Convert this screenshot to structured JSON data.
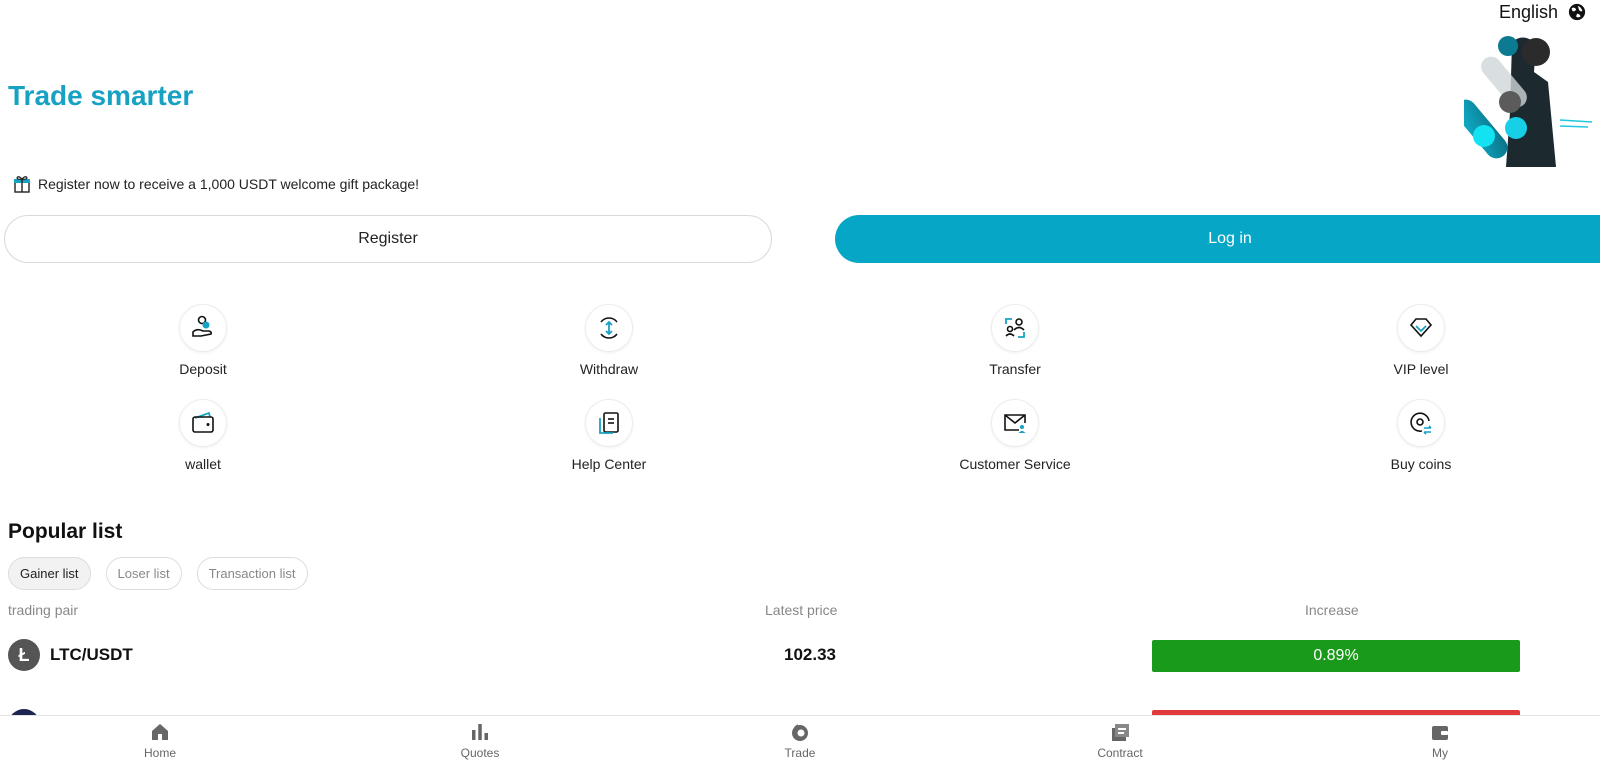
{
  "header": {
    "language": "English",
    "language_icon": "globe-icon"
  },
  "hero": {
    "title": "Trade smarter",
    "art_icon": "promo-athlete-image"
  },
  "gift": {
    "icon": "gift-icon",
    "text": "Register now to receive a 1,000 USDT welcome gift package!"
  },
  "auth": {
    "register_label": "Register",
    "login_label": "Log in"
  },
  "quick_actions": [
    {
      "label": "Deposit",
      "icon": "deposit-icon"
    },
    {
      "label": "Withdraw",
      "icon": "withdraw-icon"
    },
    {
      "label": "Transfer",
      "icon": "transfer-icon"
    },
    {
      "label": "VIP level",
      "icon": "diamond-icon"
    },
    {
      "label": "wallet",
      "icon": "wallet-icon"
    },
    {
      "label": "Help Center",
      "icon": "help-center-icon"
    },
    {
      "label": "Customer Service",
      "icon": "mail-user-icon"
    },
    {
      "label": "Buy coins",
      "icon": "buy-coins-icon"
    }
  ],
  "popular": {
    "title": "Popular list",
    "tabs": [
      "Gainer list",
      "Loser list",
      "Transaction list"
    ],
    "active_tab": "Gainer list",
    "columns": {
      "pair": "trading pair",
      "price": "Latest price",
      "increase": "Increase"
    },
    "rows": [
      {
        "icon": "ltc-coin-icon",
        "glyph": "Ł",
        "pair": "LTC/USDT",
        "price": "102.33",
        "increase": "0.89%",
        "color": "#1a9a1a"
      },
      {
        "icon": "coin-icon",
        "glyph": "",
        "pair": "",
        "price": "",
        "increase": "",
        "color": "#e03a3a"
      }
    ]
  },
  "bottom_nav": [
    {
      "label": "Home",
      "icon": "home-icon"
    },
    {
      "label": "Quotes",
      "icon": "bar-chart-icon"
    },
    {
      "label": "Trade",
      "icon": "trade-icon"
    },
    {
      "label": "Contract",
      "icon": "contract-icon"
    },
    {
      "label": "My",
      "icon": "wallet-icon"
    }
  ],
  "colors": {
    "accent": "#06a7c6",
    "title": "#17a2c3",
    "gain": "#1a9a1a",
    "loss": "#e03a3a"
  }
}
